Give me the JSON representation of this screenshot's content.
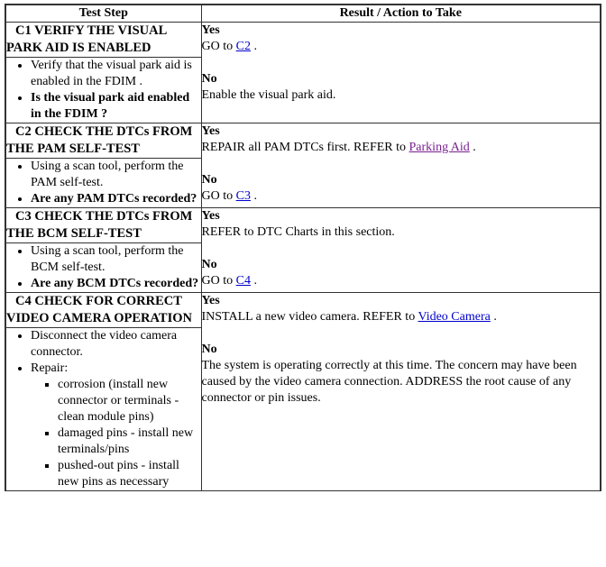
{
  "table": {
    "headers": {
      "step": "Test Step",
      "result": "Result / Action to Take"
    },
    "link_colors": {
      "link": "#0000cc",
      "visited": "#7a1f8f"
    },
    "sections": [
      {
        "id": "C1",
        "title_line1": "C1 VERIFY THE VISUAL",
        "title_line2": "PARK AID IS ENABLED",
        "steps": [
          {
            "text": "Verify that the visual park aid is enabled in the FDIM .",
            "bold": false
          },
          {
            "text": "Is the visual park aid enabled in the FDIM ?",
            "bold": true
          }
        ],
        "results": [
          {
            "answer": "Yes",
            "before_link": "GO to ",
            "link_text": "C2",
            "link_style": "link",
            "after_link": " ."
          },
          {
            "answer": "No",
            "before_link": "Enable the visual park aid.",
            "link_text": "",
            "link_style": "",
            "after_link": ""
          }
        ]
      },
      {
        "id": "C2",
        "title_line1": "C2 CHECK THE DTCs FROM",
        "title_line2": "THE PAM SELF-TEST",
        "steps": [
          {
            "text": "Using a scan tool, perform the PAM self-test.",
            "bold": false
          },
          {
            "text": "Are any PAM DTCs recorded?",
            "bold": true
          }
        ],
        "results": [
          {
            "answer": "Yes",
            "before_link": "REPAIR all PAM DTCs first. REFER to ",
            "link_text": "Parking Aid",
            "link_style": "visited",
            "after_link": " ."
          },
          {
            "answer": "No",
            "before_link": "GO to ",
            "link_text": "C3",
            "link_style": "link",
            "after_link": " ."
          }
        ]
      },
      {
        "id": "C3",
        "title_line1": "C3 CHECK THE DTCs FROM",
        "title_line2": "THE BCM SELF-TEST",
        "steps": [
          {
            "text": "Using a scan tool, perform the BCM self-test.",
            "bold": false
          },
          {
            "text": "Are any BCM DTCs recorded?",
            "bold": true
          }
        ],
        "results": [
          {
            "answer": "Yes",
            "before_link": "REFER to DTC Charts in this section.",
            "link_text": "",
            "link_style": "",
            "after_link": ""
          },
          {
            "answer": "No",
            "before_link": "GO to ",
            "link_text": "C4",
            "link_style": "link",
            "after_link": " ."
          }
        ]
      },
      {
        "id": "C4",
        "title_line1": "C4 CHECK FOR CORRECT",
        "title_line2": "VIDEO CAMERA OPERATION",
        "steps": [
          {
            "text": "Disconnect the video camera connector.",
            "bold": false
          },
          {
            "text": "Repair:",
            "bold": false
          }
        ],
        "substeps": [
          "corrosion (install new connector or terminals - clean module pins)",
          "damaged pins - install new terminals/pins",
          "pushed-out pins - install new pins as necessary"
        ],
        "results": [
          {
            "answer": "Yes",
            "before_link": "INSTALL a new video camera. REFER to ",
            "link_text": "Video Camera",
            "link_style": "link",
            "after_link": " ."
          },
          {
            "answer": "No",
            "before_link": "The system is operating correctly at this time. The concern may have been caused by the video camera connection. ADDRESS the root cause of any connector or pin issues.",
            "link_text": "",
            "link_style": "",
            "after_link": ""
          }
        ]
      }
    ]
  }
}
